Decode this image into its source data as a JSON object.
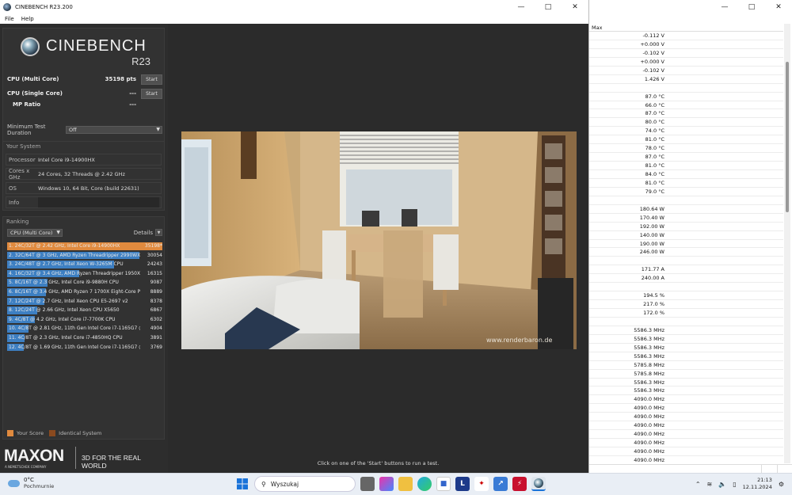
{
  "window": {
    "title": "CINEBENCH R23.200"
  },
  "menu": [
    "File",
    "Help"
  ],
  "logo": {
    "brand": "CINEBENCH",
    "version": "R23"
  },
  "bench": {
    "multi_label": "CPU (Multi Core)",
    "multi_score": "35198 pts",
    "single_label": "CPU (Single Core)",
    "single_score": "---",
    "mp_label": "MP Ratio",
    "mp_value": "---",
    "start_label": "Start"
  },
  "duration": {
    "label": "Minimum Test Duration",
    "value": "Off"
  },
  "system": {
    "title": "Your System",
    "processor_label": "Processor",
    "processor": "Intel Core i9-14900HX",
    "cores_label": "Cores x GHz",
    "cores": "24 Cores, 32 Threads @ 2.42 GHz",
    "os_label": "OS",
    "os": "Windows 10, 64 Bit, Core (build 22631)",
    "info_label": "Info"
  },
  "ranking": {
    "title": "Ranking",
    "selector": "CPU (Multi Core)",
    "details_label": "Details",
    "items": [
      {
        "name": "1. 24C/32T @ 2.42 GHz, Intel Core i9-14900HX",
        "score": "35198*",
        "value": 35198,
        "mine": true
      },
      {
        "name": "2. 32C/64T @ 3 GHz, AMD Ryzen Threadripper 2990WX",
        "score": "30054",
        "value": 30054
      },
      {
        "name": "3. 24C/48T @ 2.7 GHz, Intel Xeon W-3265M CPU",
        "score": "24243",
        "value": 24243
      },
      {
        "name": "4. 16C/32T @ 3.4 GHz, AMD Ryzen Threadripper 1950X 1",
        "score": "16315",
        "value": 16315
      },
      {
        "name": "5. 8C/16T @ 2.3 GHz, Intel Core i9-9880H CPU",
        "score": "9087",
        "value": 9087
      },
      {
        "name": "6. 8C/16T @ 3.4 GHz, AMD Ryzen 7 1700X Eight-Core Pro",
        "score": "8889",
        "value": 8889
      },
      {
        "name": "7. 12C/24T @ 2.7 GHz, Intel Xeon CPU E5-2697 v2",
        "score": "8378",
        "value": 8378
      },
      {
        "name": "8. 12C/24T @ 2.66 GHz, Intel Xeon CPU X5650",
        "score": "6867",
        "value": 6867
      },
      {
        "name": "9. 4C/8T @ 4.2 GHz, Intel Core i7-7700K CPU",
        "score": "6302",
        "value": 6302
      },
      {
        "name": "10. 4C/8T @ 2.81 GHz, 11th Gen Intel Core i7-1165G7 @ 2",
        "score": "4904",
        "value": 4904
      },
      {
        "name": "11. 4C/8T @ 2.3 GHz, Intel Core i7-4850HQ CPU",
        "score": "3891",
        "value": 3891
      },
      {
        "name": "12. 4C/8T @ 1.69 GHz, 11th Gen Intel Core i7-1165G7 @1",
        "score": "3769",
        "value": 3769
      }
    ],
    "legend_your": "Your Score",
    "legend_identical": "Identical System",
    "color_your": "#e08a3e",
    "color_identical": "#8a4a1f",
    "color_bar": "#3d7fc2"
  },
  "maxon": {
    "logo": "MAXON",
    "sub": "A NEMETSCHEK COMPANY",
    "tagline": "3D FOR THE REAL WORLD"
  },
  "render": {
    "watermark": "www.renderbaron.de"
  },
  "status": "Click on one of the 'Start' buttons to run a test.",
  "monitor": {
    "column_header": "Max",
    "values": [
      "-0.112 V",
      "+0.000 V",
      "-0.102 V",
      "+0.000 V",
      "-0.102 V",
      "1.426 V",
      "",
      "87.0 °C",
      "66.0 °C",
      "87.0 °C",
      "80.0 °C",
      "74.0 °C",
      "81.0 °C",
      "78.0 °C",
      "87.0 °C",
      "81.0 °C",
      "84.0 °C",
      "81.0 °C",
      "79.0 °C",
      "",
      "180.64 W",
      "170.40 W",
      "192.00 W",
      "140.00 W",
      "190.00 W",
      "246.00 W",
      "",
      "171.77 A",
      "240.00 A",
      "",
      "194.5 %",
      "217.0 %",
      "172.0 %",
      "",
      "5586.3 MHz",
      "5586.3 MHz",
      "5586.3 MHz",
      "5586.3 MHz",
      "5785.8 MHz",
      "5785.8 MHz",
      "5586.3 MHz",
      "5586.3 MHz",
      "4090.0 MHz",
      "4090.0 MHz",
      "4090.0 MHz",
      "4090.0 MHz",
      "4090.0 MHz",
      "4090.0 MHz",
      "4090.0 MHz",
      "4090.0 MHz"
    ]
  },
  "taskbar": {
    "temp": "0°C",
    "weather": "Pochmurnie",
    "search_placeholder": "Wyszukaj",
    "time": "21:13",
    "date": "12.11.2024"
  }
}
